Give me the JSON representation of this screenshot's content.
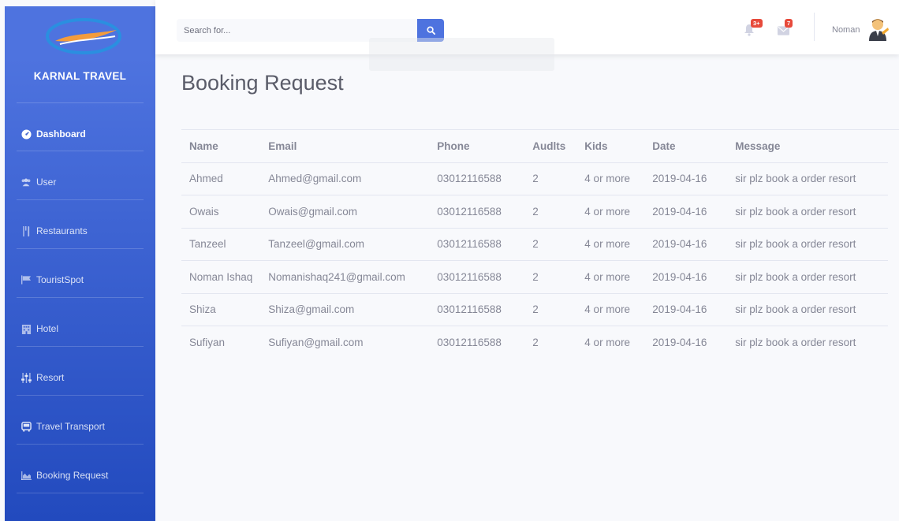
{
  "brand": {
    "name": "KARNAL TRAVEL"
  },
  "sidebar": {
    "items": [
      {
        "label": "Dashboard",
        "icon": "tachometer-icon",
        "active": true
      },
      {
        "label": "User",
        "icon": "users-icon"
      },
      {
        "label": "Restaurants",
        "icon": "utensils-icon"
      },
      {
        "label": "TouristSpot",
        "icon": "flag-icon"
      },
      {
        "label": "Hotel",
        "icon": "building-icon"
      },
      {
        "label": "Resort",
        "icon": "sliders-icon"
      },
      {
        "label": "Travel Transport",
        "icon": "bus-icon"
      },
      {
        "label": "Booking Request",
        "icon": "chart-area-icon"
      }
    ]
  },
  "topbar": {
    "search_placeholder": "Search for...",
    "alerts_badge": "3+",
    "messages_badge": "7",
    "user_name": "Noman"
  },
  "page": {
    "title": "Booking Request"
  },
  "table": {
    "headers": [
      "Name",
      "Email",
      "Phone",
      "Audlts",
      "Kids",
      "Date",
      "Message"
    ],
    "rows": [
      [
        "Ahmed",
        "Ahmed@gmail.com",
        "03012116588",
        "2",
        "4 or more",
        "2019-04-16",
        "sir plz book a order resort"
      ],
      [
        "Owais",
        "Owais@gmail.com",
        "03012116588",
        "2",
        "4 or more",
        "2019-04-16",
        "sir plz book a order resort"
      ],
      [
        "Tanzeel",
        "Tanzeel@gmail.com",
        "03012116588",
        "2",
        "4 or more",
        "2019-04-16",
        "sir plz book a order resort"
      ],
      [
        "Noman Ishaq",
        "Nomanishaq241@gmail.com",
        "03012116588",
        "2",
        "4 or more",
        "2019-04-16",
        "sir plz book a order resort"
      ],
      [
        "Shiza",
        "Shiza@gmail.com",
        "03012116588",
        "2",
        "4 or more",
        "2019-04-16",
        "sir plz book a order resort"
      ],
      [
        "Sufiyan",
        "Sufiyan@gmail.com",
        "03012116588",
        "2",
        "4 or more",
        "2019-04-16",
        "sir plz book a order resort"
      ]
    ]
  },
  "colors": {
    "primary": "#4e73df",
    "primary_dark": "#224abe",
    "danger": "#e74a3b",
    "text": "#858796"
  }
}
